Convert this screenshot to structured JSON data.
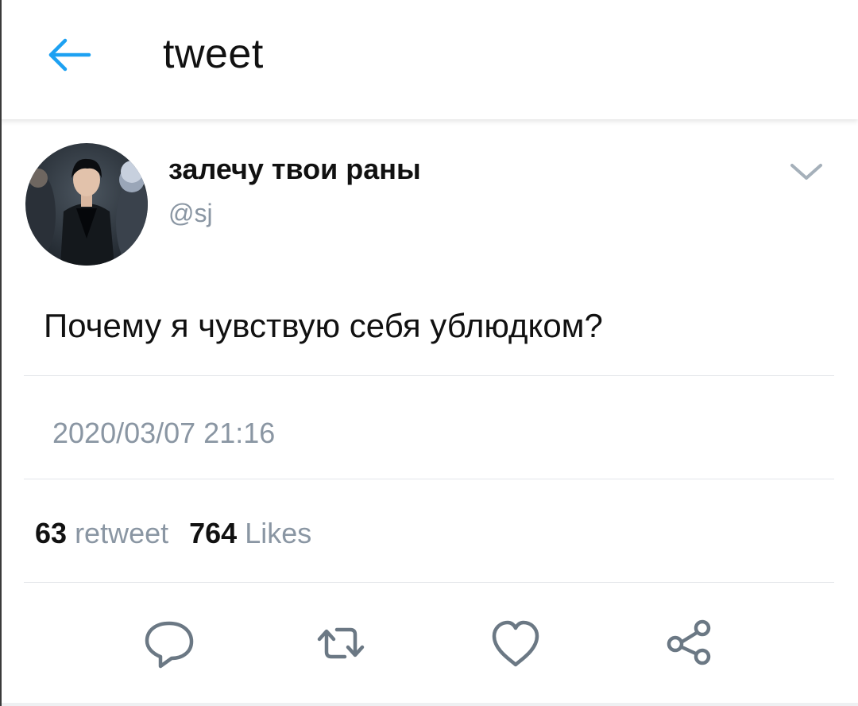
{
  "header": {
    "title": "tweet",
    "back_icon": "arrow-left-icon",
    "accent_color": "#1da1f2"
  },
  "tweet": {
    "display_name": "залечу твои раны",
    "handle": "@sj",
    "text": "Почему я чувствую себя ублюдком?",
    "timestamp": "2020/03/07 21:16",
    "menu_icon": "chevron-down-icon"
  },
  "stats": {
    "retweet_count": "63",
    "retweet_label": "retweet",
    "likes_count": "764",
    "likes_label": "Likes"
  },
  "actions": [
    {
      "name": "reply",
      "icon": "reply-bubble-icon"
    },
    {
      "name": "retweet",
      "icon": "retweet-arrows-icon"
    },
    {
      "name": "like",
      "icon": "heart-icon"
    },
    {
      "name": "share",
      "icon": "share-nodes-icon"
    }
  ],
  "colors": {
    "text_primary": "#111111",
    "text_secondary": "#8a96a3",
    "icon_gray": "#6b7884",
    "divider": "#e3e6ea"
  }
}
